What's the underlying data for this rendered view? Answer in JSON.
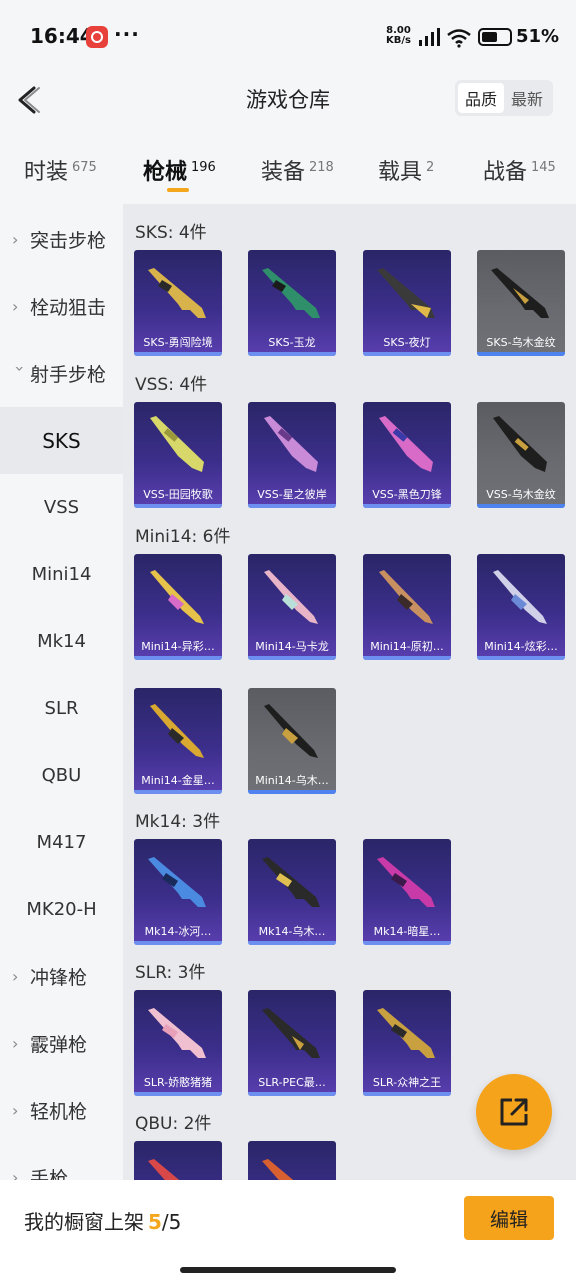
{
  "status_bar": {
    "time": "16:44",
    "more": "···",
    "speed_value": "8.00",
    "speed_unit": "KB/s",
    "battery": "51%"
  },
  "header": {
    "title": "游戏仓库",
    "sort": {
      "quality": "品质",
      "newest": "最新"
    }
  },
  "tabs": [
    {
      "label": "时装",
      "count": "675"
    },
    {
      "label": "枪械",
      "count": "196"
    },
    {
      "label": "装备",
      "count": "218"
    },
    {
      "label": "载具",
      "count": "2"
    },
    {
      "label": "战备",
      "count": "145"
    }
  ],
  "sidebar": {
    "assault_rifle": "突击步枪",
    "bolt_sniper": "栓动狙击",
    "marksman_rifle": "射手步枪",
    "sks": "SKS",
    "vss": "VSS",
    "mini14": "Mini14",
    "mk14": "Mk14",
    "slr": "SLR",
    "qbu": "QBU",
    "m417": "M417",
    "mk20h": "MK20-H",
    "smg": "冲锋枪",
    "shotgun": "霰弹枪",
    "lmg": "轻机枪",
    "pistol": "手枪"
  },
  "sections": {
    "sks": {
      "title": "SKS: 4件",
      "items": [
        "SKS-勇闯险境",
        "SKS-玉龙",
        "SKS-夜灯",
        "SKS-乌木金纹"
      ]
    },
    "vss": {
      "title": "VSS: 4件",
      "items": [
        "VSS-田园牧歌",
        "VSS-星之彼岸",
        "VSS-黑色刀锋",
        "VSS-乌木金纹"
      ]
    },
    "mini14": {
      "title": "Mini14: 6件",
      "items": [
        "Mini14-异彩…",
        "Mini14-马卡龙",
        "Mini14-原初…",
        "Mini14-炫彩…",
        "Mini14-金星…",
        "Mini14-乌木…"
      ]
    },
    "mk14": {
      "title": "Mk14: 3件",
      "items": [
        "Mk14-冰河…",
        "Mk14-乌木…",
        "Mk14-暗星…"
      ]
    },
    "slr": {
      "title": "SLR: 3件",
      "items": [
        "SLR-娇憨猪猪",
        "SLR-PEC最…",
        "SLR-众神之王"
      ]
    },
    "qbu": {
      "title": "QBU: 2件"
    }
  },
  "bottom": {
    "showcase_label": "我的橱窗上架",
    "showcase_current": "5",
    "showcase_total": "/5",
    "edit": "编辑"
  },
  "colors": {
    "accent": "#f5a31b",
    "card_purple": "#3b2e8a",
    "card_gray": "#6a6b70"
  }
}
